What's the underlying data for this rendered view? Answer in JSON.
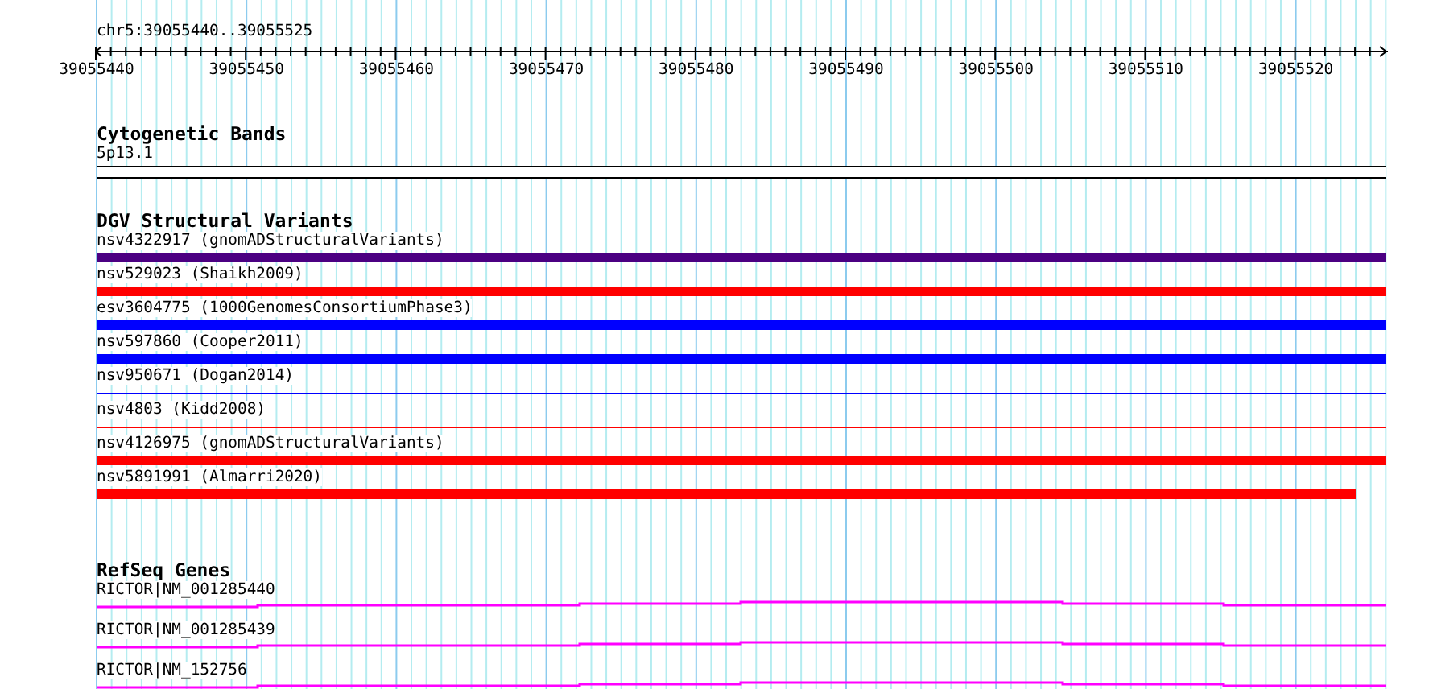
{
  "location": "chr5:39055440..39055525",
  "ruler": {
    "labels": [
      "39055440",
      "39055450",
      "39055460",
      "39055470",
      "39055480",
      "39055490",
      "39055500",
      "39055510",
      "39055520"
    ]
  },
  "tracks": [
    {
      "kind": "bands",
      "title": "Cytogenetic Bands",
      "features": [
        {
          "label": "5p13.1"
        }
      ]
    },
    {
      "kind": "variants",
      "title": "DGV Structural Variants",
      "features": [
        {
          "label": "nsv4322917 (gnomADStructuralVariants)",
          "kind": "thick",
          "color": "#4b0082",
          "truncated": false
        },
        {
          "label": "nsv529023 (Shaikh2009)",
          "kind": "thick",
          "color": "#ff0000",
          "truncated": false
        },
        {
          "label": "esv3604775 (1000GenomesConsortiumPhase3)",
          "kind": "thick",
          "color": "#0000ff",
          "truncated": false
        },
        {
          "label": "nsv597860 (Cooper2011)",
          "kind": "thick",
          "color": "#0000ff",
          "truncated": false
        },
        {
          "label": "nsv950671 (Dogan2014)",
          "kind": "thin",
          "color": "#0000ff",
          "truncated": false
        },
        {
          "label": "nsv4803 (Kidd2008)",
          "kind": "thin",
          "color": "#ff0000",
          "truncated": false
        },
        {
          "label": "nsv4126975 (gnomADStructuralVariants)",
          "kind": "thick",
          "color": "#ff0000",
          "truncated": false
        },
        {
          "label": "nsv5891991 (Almarri2020)",
          "kind": "thick",
          "color": "#ff0000",
          "truncated": true
        }
      ]
    },
    {
      "kind": "genes",
      "title": "RefSeq Genes",
      "features": [
        {
          "label": "RICTOR|NM_001285440"
        },
        {
          "label": "RICTOR|NM_001285439"
        },
        {
          "label": "RICTOR|NM_152756"
        }
      ]
    }
  ]
}
